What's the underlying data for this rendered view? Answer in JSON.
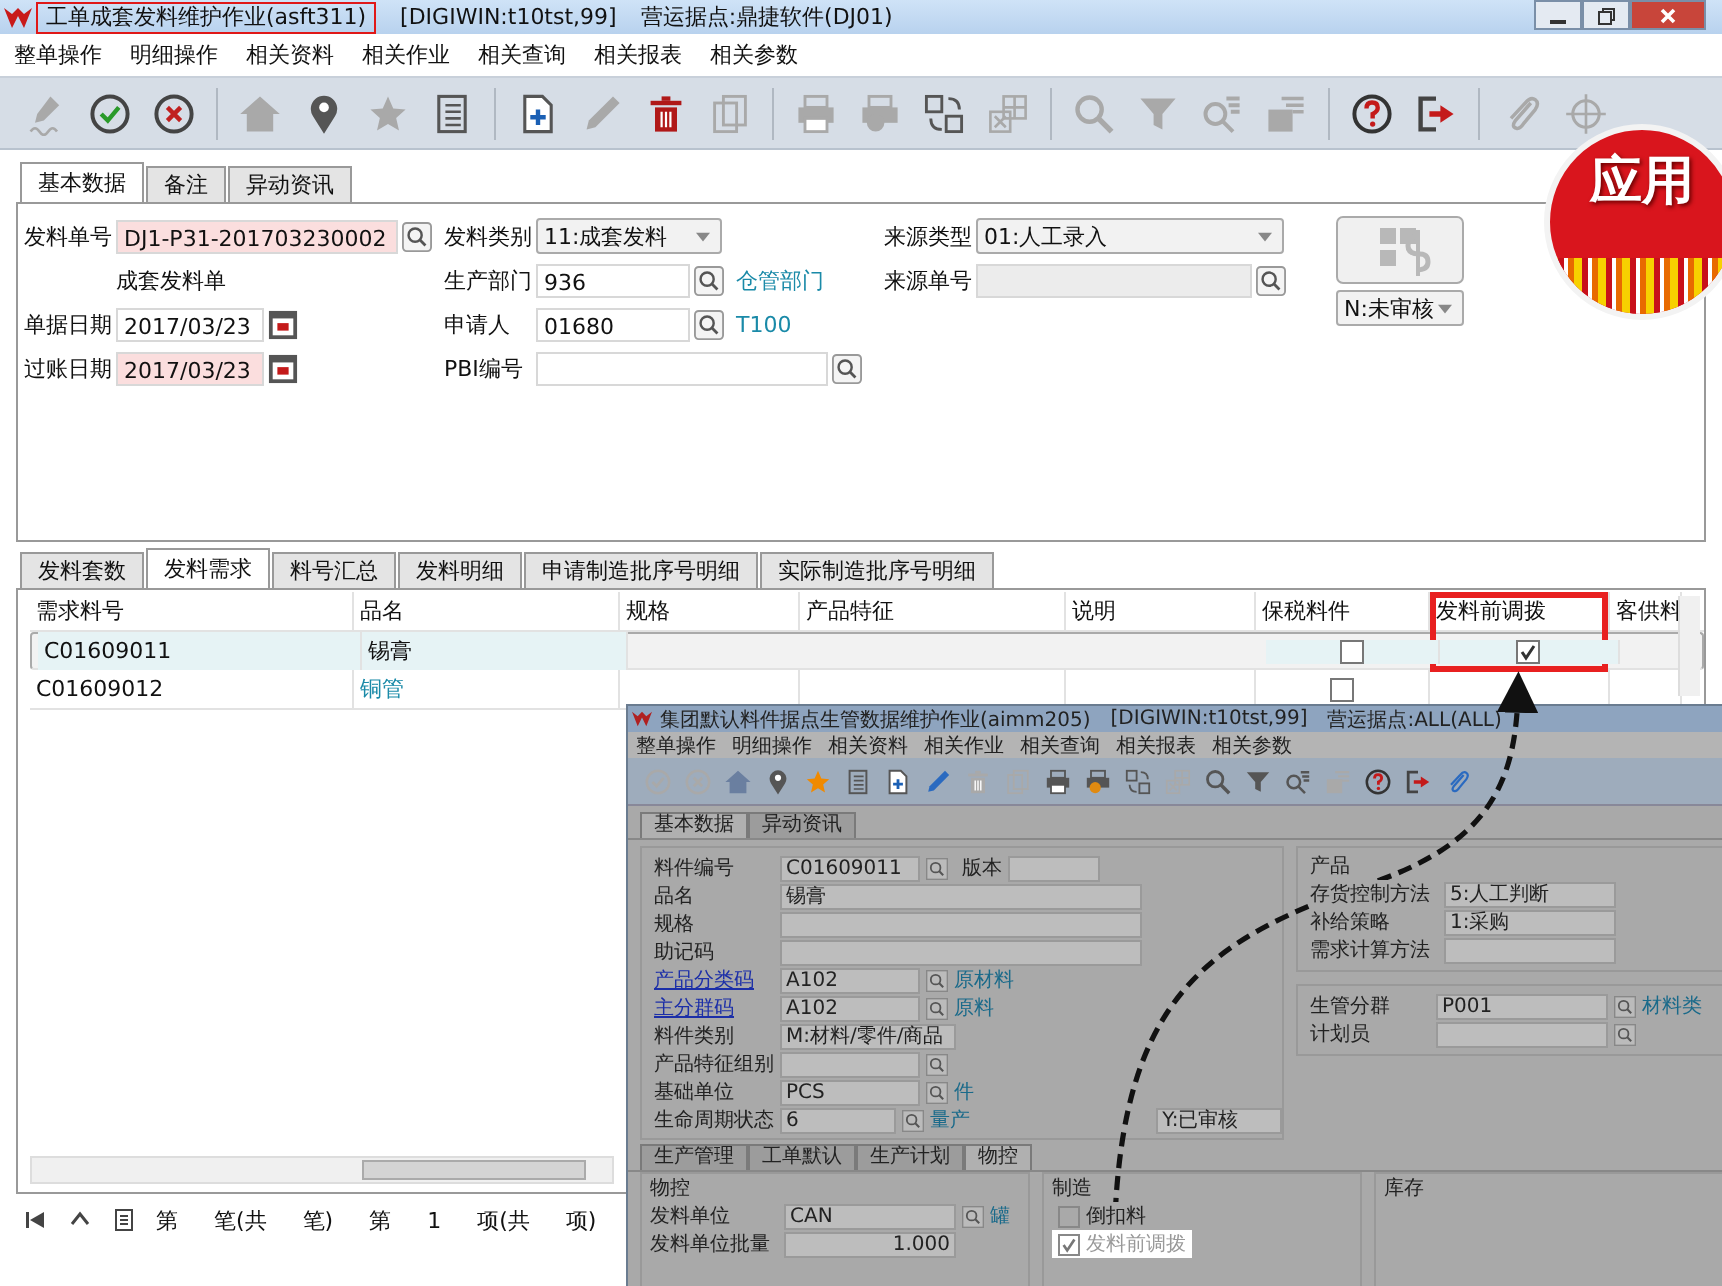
{
  "window": {
    "app_title": "工单成套发料维护作业(asft311)",
    "title_highlighted": true,
    "connection": "[DIGIWIN:t10tst,99]",
    "site": "营运据点:鼎捷软件(DJ01)"
  },
  "menu": [
    "整单操作",
    "明细操作",
    "相关资料",
    "相关作业",
    "相关查询",
    "相关报表",
    "相关参数"
  ],
  "toolbar": [
    [
      {
        "disabled": true
      },
      {
        "disabled": false
      },
      {
        "disabled": false
      }
    ],
    [
      {
        "disabled": true
      },
      {
        "disabled": false
      },
      {
        "disabled": true
      },
      {
        "disabled": false
      }
    ],
    [
      {
        "disabled": false
      },
      {
        "disabled": true
      },
      {
        "disabled": false
      },
      {
        "disabled": true
      }
    ],
    [
      {
        "disabled": true
      },
      {
        "disabled": true
      },
      {
        "disabled": false
      },
      {
        "disabled": true
      }
    ],
    [
      {
        "disabled": true
      },
      {
        "disabled": true
      },
      {
        "disabled": true
      },
      {
        "disabled": true
      }
    ],
    [
      {
        "disabled": false
      },
      {
        "disabled": false
      }
    ],
    [
      {
        "disabled": true
      },
      {
        "disabled": true
      }
    ]
  ],
  "badge": {
    "text": "应用"
  },
  "header_tabs": [
    {
      "label": "基本数据",
      "selected": true
    },
    {
      "label": "备注",
      "selected": false
    },
    {
      "label": "异动资讯",
      "selected": false
    }
  ],
  "form": {
    "columns": [
      [
        {
          "kind": "lookup",
          "label": "发料单号",
          "value": "DJ1-P31-201703230002",
          "required": true,
          "disabled": false
        },
        {
          "kind": "note",
          "text": "成套发料单"
        },
        {
          "kind": "date",
          "label": "单据日期",
          "value": "2017/03/23",
          "required": false,
          "disabled": false
        },
        {
          "kind": "date",
          "label": "过账日期",
          "value": "2017/03/23",
          "required": true,
          "disabled": false
        }
      ],
      [
        {
          "kind": "select",
          "label": "发料类别",
          "value": "11:成套发料"
        },
        {
          "kind": "lookup",
          "label": "生产部门",
          "value": "936",
          "required": false,
          "disabled": false,
          "link": "仓管部门"
        },
        {
          "kind": "lookup",
          "label": "申请人",
          "value": "01680",
          "required": false,
          "disabled": false,
          "link": "T100"
        },
        {
          "kind": "lookup",
          "label": "PBI编号",
          "required": false,
          "disabled": false
        }
      ],
      [
        {
          "kind": "select",
          "label": "来源类型",
          "value": "01:人工录入"
        },
        {
          "kind": "lookup",
          "label": "来源单号",
          "required": false,
          "disabled": true
        }
      ]
    ],
    "approve_button": {
      "disabled": true
    },
    "status": "N:未审核"
  },
  "detail_tabs": [
    {
      "label": "发料套数",
      "selected": false
    },
    {
      "label": "发料需求",
      "selected": true
    },
    {
      "label": "料号汇总",
      "selected": false
    },
    {
      "label": "发料明细",
      "selected": false
    },
    {
      "label": "申请制造批序号明细",
      "selected": false
    },
    {
      "label": "实际制造批序号明细",
      "selected": false
    }
  ],
  "grid": {
    "columns": [
      {
        "label": "需求料号",
        "highlighted": false
      },
      {
        "label": "品名",
        "highlighted": false
      },
      {
        "label": "规格",
        "highlighted": false
      },
      {
        "label": "产品特征",
        "highlighted": false
      },
      {
        "label": "说明",
        "highlighted": false
      },
      {
        "label": "保税料件",
        "highlighted": false
      },
      {
        "label": "发料前调拨",
        "highlighted": true
      },
      {
        "label": "客供料",
        "highlighted": false
      }
    ],
    "rows": [
      {
        "item_no": "C01609011",
        "name": "锡膏",
        "bonded": false,
        "pre_transfer": true,
        "selected": true
      },
      {
        "item_no": "C01609012",
        "name": "铜管",
        "bonded": false,
        "selected": false
      }
    ]
  },
  "status_bar": [
    "第",
    "笔(共",
    "笔)",
    "第",
    "1",
    "项(共",
    "项)"
  ],
  "inset": {
    "title": "集团默认料件据点生管数据维护作业(aimm205)",
    "connection": "[DIGIWIN:t10tst,99]",
    "site": "营运据点:ALL(ALL)",
    "menu": [
      "整单操作",
      "明细操作",
      "相关资料",
      "相关作业",
      "相关查询",
      "相关报表",
      "相关参数"
    ],
    "toolbar": [
      {
        "disabled": true
      },
      {
        "disabled": true
      },
      {
        "disabled": false
      },
      {
        "disabled": false
      },
      {
        "disabled": false
      },
      {
        "disabled": false
      },
      {
        "disabled": false
      },
      {
        "disabled": false
      },
      {
        "disabled": true
      },
      {
        "disabled": true
      },
      {
        "disabled": false
      },
      {
        "disabled": false
      },
      {
        "disabled": false
      },
      {
        "disabled": true
      },
      {
        "disabled": false
      },
      {
        "disabled": false
      },
      {
        "disabled": false
      },
      {
        "disabled": true
      },
      {
        "disabled": false
      },
      {
        "disabled": false
      },
      {
        "disabled": false
      }
    ],
    "tabs": [
      {
        "label": "基本数据",
        "selected": true
      },
      {
        "label": "异动资讯",
        "selected": false
      }
    ],
    "fields": [
      {
        "kind": "lookup",
        "label": "料件编号",
        "value": "C01609011",
        "label_link": false,
        "extra": "版本"
      },
      {
        "kind": "text",
        "label": "品名",
        "value": "锡膏",
        "label_link": false
      },
      {
        "kind": "text",
        "label": "规格",
        "label_link": false
      },
      {
        "kind": "text",
        "label": "助记码",
        "label_link": false
      },
      {
        "kind": "lookup",
        "label": "产品分类码",
        "value": "A102",
        "label_link": true,
        "link": "原材料"
      },
      {
        "kind": "lookup",
        "label": "主分群码",
        "value": "A102",
        "label_link": true,
        "link": "原料"
      },
      {
        "kind": "select",
        "label": "料件类别",
        "value": "M:材料/零件/商品",
        "label_link": false
      },
      {
        "kind": "lookup",
        "label": "产品特征组别",
        "label_link": false
      },
      {
        "kind": "lookup",
        "label": "基础单位",
        "value": "PCS",
        "label_link": false,
        "link": "件"
      },
      {
        "kind": "lookup",
        "label": "生命周期状态",
        "value": "6",
        "label_link": false,
        "link": "量产"
      }
    ],
    "status_select": "Y:已审核",
    "product": {
      "title": "产品",
      "fields": [
        {
          "label": "存货控制方法",
          "value": "5:人工判断"
        },
        {
          "label": "补给策略",
          "value": "1:采购"
        },
        {
          "label": "需求计算方法"
        }
      ]
    },
    "planning": [
      {
        "label": "生管分群",
        "value": "P001",
        "link": "材料类"
      },
      {
        "label": "计划员"
      }
    ],
    "lower_tabs": [
      {
        "label": "生产管理",
        "selected": false
      },
      {
        "label": "工单默认",
        "selected": false
      },
      {
        "label": "生产计划",
        "selected": false
      },
      {
        "label": "物控",
        "selected": true
      }
    ],
    "material": {
      "title": "物控",
      "fields": [
        {
          "kind": "lookup",
          "label": "发料单位",
          "value": "CAN",
          "link": "罐"
        },
        {
          "kind": "text",
          "label": "发料单位批量",
          "value": "1.000"
        }
      ]
    },
    "manufacturing": {
      "title": "制造",
      "options": [
        {
          "label": "倒扣料",
          "checked": false,
          "highlighted": false
        },
        {
          "label": "发料前调拨",
          "checked": true,
          "highlighted": true
        }
      ]
    },
    "stock": {
      "title": "库存"
    }
  }
}
